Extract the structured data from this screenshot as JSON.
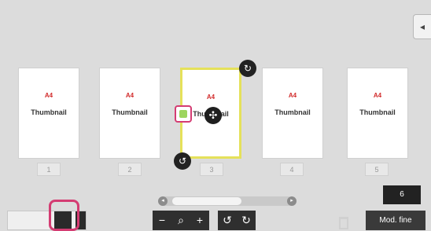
{
  "pages": [
    {
      "size": "A4",
      "label": "Thumbnail",
      "number": "1"
    },
    {
      "size": "A4",
      "label": "Thumbnail",
      "number": "2"
    },
    {
      "size": "A4",
      "label": "Thumbnail",
      "number": "3"
    },
    {
      "size": "A4",
      "label": "Thumbnail",
      "number": "4"
    },
    {
      "size": "A4",
      "label": "Thumbnail",
      "number": "5"
    }
  ],
  "page_count": "6",
  "mod_fine_label": "Mod. fine",
  "icons": {
    "rotate": "rotate-icon",
    "move": "move-icon",
    "bookmark": "bookmark-icon",
    "zoom_out": "zoom-out-icon",
    "zoom": "zoom-icon",
    "zoom_in": "zoom-in-icon",
    "rotate_left": "rotate-left-icon",
    "rotate_right": "rotate-right-icon",
    "delete": "trash-icon",
    "collapse": "collapse-panel-icon"
  }
}
